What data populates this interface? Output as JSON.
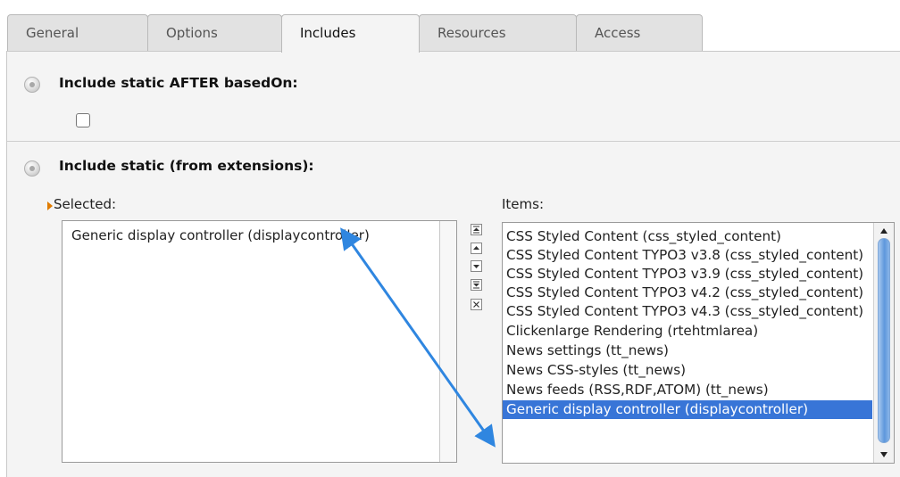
{
  "tabs": [
    {
      "label": "General",
      "active": false
    },
    {
      "label": "Options",
      "active": false
    },
    {
      "label": "Includes",
      "active": true
    },
    {
      "label": "Resources",
      "active": false
    },
    {
      "label": "Access",
      "active": false
    }
  ],
  "section1": {
    "label": "Include static AFTER basedOn:",
    "checkbox_checked": false
  },
  "section2": {
    "label": "Include static (from extensions):",
    "selected_label": "Selected:",
    "items_label": "Items:",
    "selected_items": [
      "Generic display controller (displaycontroller)"
    ],
    "items": [
      "CSS Styled Content (css_styled_content)",
      "CSS Styled Content TYPO3 v3.8 (css_styled_content)",
      "CSS Styled Content TYPO3 v3.9 (css_styled_content)",
      "CSS Styled Content TYPO3 v4.2 (css_styled_content)",
      "CSS Styled Content TYPO3 v4.3 (css_styled_content)",
      "Clickenlarge Rendering (rtehtmlarea)",
      "News settings (tt_news)",
      "News CSS-styles (tt_news)",
      "News feeds (RSS,RDF,ATOM) (tt_news)",
      "Generic display controller (displaycontroller)"
    ],
    "highlighted_item": 9,
    "controls": [
      "move-to-top-icon",
      "move-up-icon",
      "move-down-icon",
      "move-to-bottom-icon",
      "remove-icon"
    ]
  },
  "colors": {
    "selection": "#3875d7",
    "annotation_arrow": "#2f86e0",
    "caret": "#e07b00"
  }
}
